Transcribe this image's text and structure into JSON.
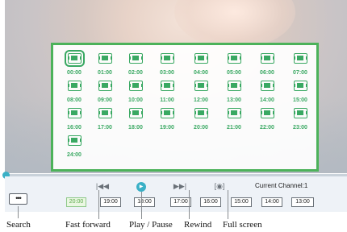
{
  "player": {
    "channels": [
      {
        "label": "00:00",
        "selected": true
      },
      {
        "label": "01:00"
      },
      {
        "label": "02:00"
      },
      {
        "label": "03:00"
      },
      {
        "label": "04:00"
      },
      {
        "label": "05:00"
      },
      {
        "label": "06:00"
      },
      {
        "label": "07:00"
      },
      {
        "label": "08:00"
      },
      {
        "label": "09:00"
      },
      {
        "label": "10:00"
      },
      {
        "label": "11:00"
      },
      {
        "label": "12:00"
      },
      {
        "label": "13:00"
      },
      {
        "label": "14:00"
      },
      {
        "label": "15:00"
      },
      {
        "label": "16:00"
      },
      {
        "label": "17:00"
      },
      {
        "label": "18:00"
      },
      {
        "label": "19:00"
      },
      {
        "label": "20:00"
      },
      {
        "label": "21:00"
      },
      {
        "label": "22:00"
      },
      {
        "label": "23:00"
      },
      {
        "label": "24:00"
      }
    ],
    "seek_progress": 0.0,
    "controls": {
      "more_label": "•••",
      "fast_forward_icon": "|◀◀",
      "play_pause_icon": "▶",
      "rewind_icon": "▶▶|",
      "fullscreen_icon": "[◉]",
      "current_channel": "Current Channel:1",
      "time_buttons": [
        {
          "label": "20:00",
          "active": true
        },
        {
          "label": "19:00"
        },
        {
          "label": "18:00"
        },
        {
          "label": "17:00"
        },
        {
          "label": "16:00"
        },
        {
          "label": "15:00"
        },
        {
          "label": "14:00"
        },
        {
          "label": "13:00"
        }
      ]
    },
    "accent_color": "#3ab0c6",
    "grid_border_color": "#4cb25a"
  },
  "captions": {
    "search": "Search",
    "fast_forward": "Fast forward",
    "play_pause": "Play / Pause",
    "rewind": "Rewind",
    "full_screen": "Full screen"
  }
}
